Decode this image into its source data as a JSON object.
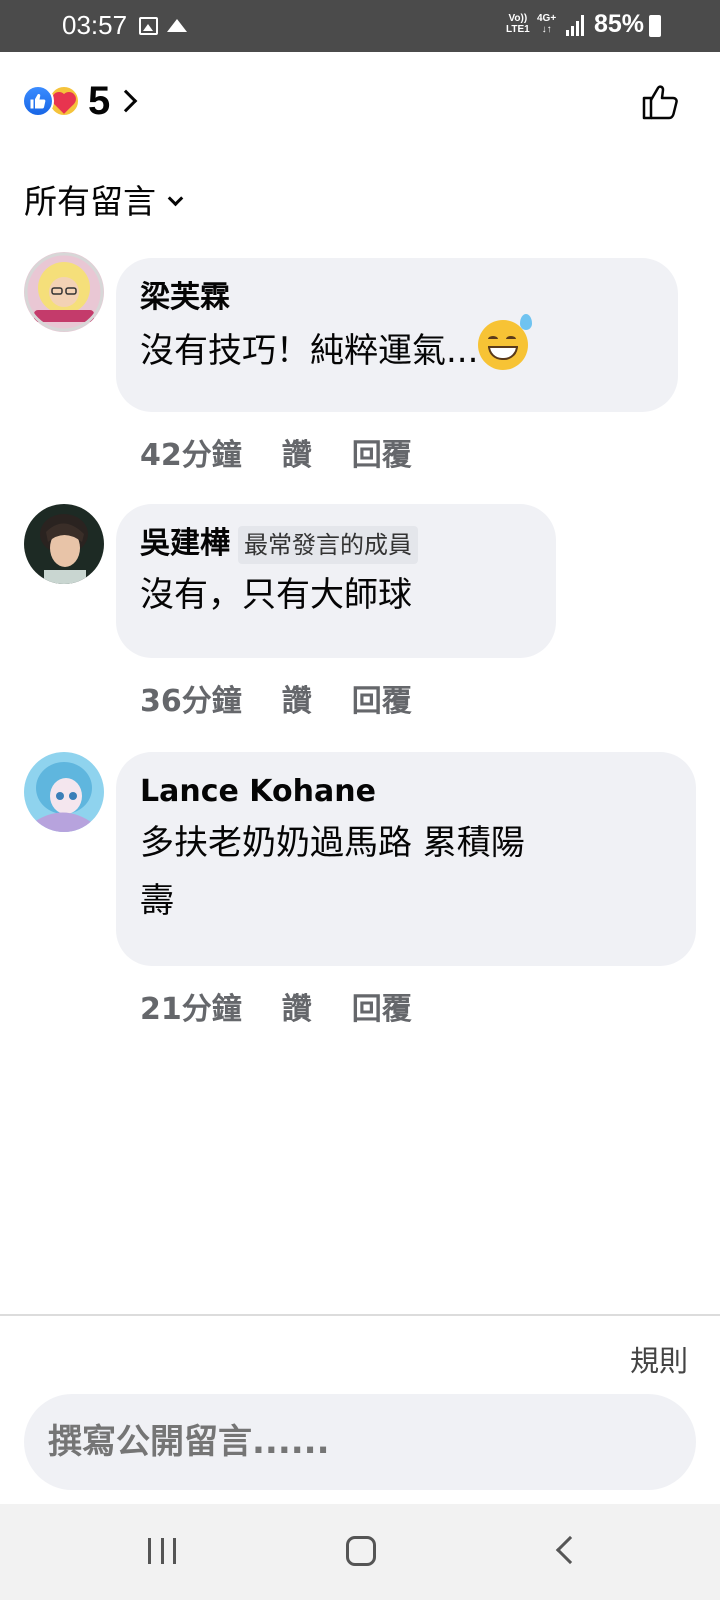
{
  "status_bar": {
    "time": "03:57",
    "volte_top": "Vo))",
    "volte_bottom": "LTE1",
    "net_top": "4G+",
    "net_bottom": "↓↑",
    "battery": "85%"
  },
  "header": {
    "reaction_count": "5",
    "reactions": [
      "like-icon",
      "care-icon"
    ]
  },
  "filter": {
    "label": "所有留言"
  },
  "comments": [
    {
      "name": "梁芙霖",
      "badge": "",
      "text_lines": [
        "沒有技巧！純粹運氣..."
      ],
      "emoji": "grinning-sweat-emoji",
      "time": "42分鐘",
      "like_label": "讚",
      "reply_label": "回覆"
    },
    {
      "name": "吳建樺",
      "badge": "最常發言的成員",
      "text_lines": [
        "沒有，只有大師球"
      ],
      "time": "36分鐘",
      "like_label": "讚",
      "reply_label": "回覆"
    },
    {
      "name": "Lance Kohane",
      "badge": "",
      "text_lines": [
        "多扶老奶奶過馬路 累積陽",
        "壽"
      ],
      "time": "21分鐘",
      "like_label": "讚",
      "reply_label": "回覆"
    }
  ],
  "footer": {
    "rules_label": "規則",
    "composer_placeholder": "撰寫公開留言......"
  },
  "colors": {
    "status_bar": "#4b4b4b",
    "bubble": "#f0f1f5",
    "meta_text": "#65676b",
    "like_blue": "#1877f2"
  }
}
